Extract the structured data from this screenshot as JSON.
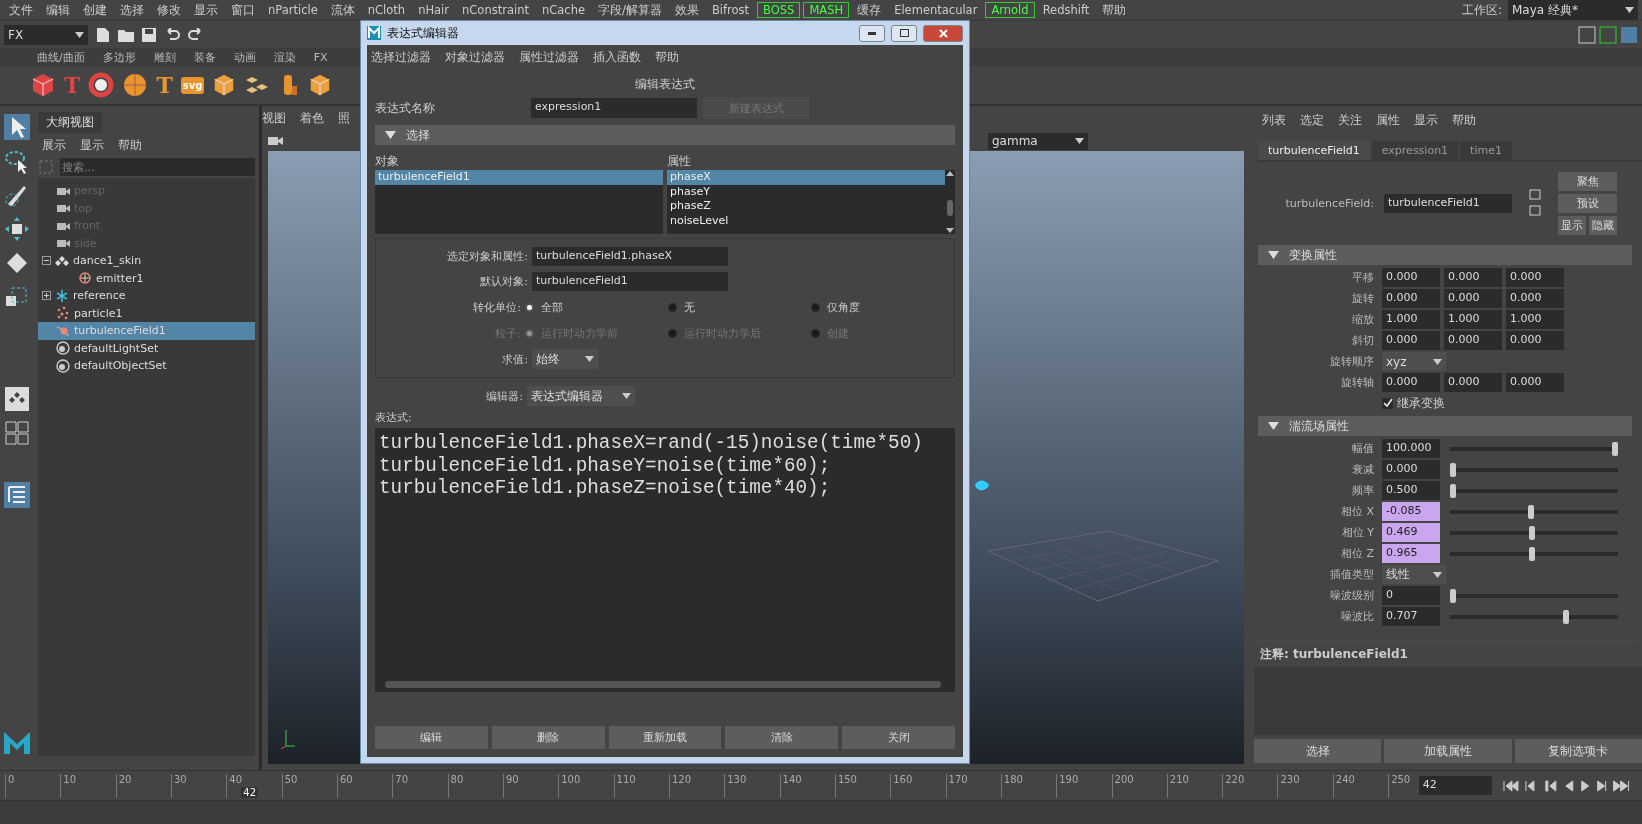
{
  "menu_bar": {
    "items": [
      {
        "label": "文件",
        "kind": "menu"
      },
      {
        "label": "编辑",
        "kind": "menu"
      },
      {
        "label": "创建",
        "kind": "menu"
      },
      {
        "label": "选择",
        "kind": "menu"
      },
      {
        "label": "修改",
        "kind": "menu"
      },
      {
        "label": "显示",
        "kind": "menu"
      },
      {
        "label": "窗口",
        "kind": "menu"
      },
      {
        "label": "nParticle",
        "kind": "menu"
      },
      {
        "label": "流体",
        "kind": "menu"
      },
      {
        "label": "nCloth",
        "kind": "menu"
      },
      {
        "label": "nHair",
        "kind": "menu"
      },
      {
        "label": "nConstraint",
        "kind": "menu"
      },
      {
        "label": "nCache",
        "kind": "menu"
      },
      {
        "label": "字段/解算器",
        "kind": "menu"
      },
      {
        "label": "效果",
        "kind": "menu"
      },
      {
        "label": "Bifrost",
        "kind": "menu"
      },
      {
        "label": "BOSS",
        "kind": "plugin"
      },
      {
        "label": "MASH",
        "kind": "plugin"
      },
      {
        "label": "缓存",
        "kind": "menu"
      },
      {
        "label": "Elementacular",
        "kind": "menu"
      },
      {
        "label": "Arnold",
        "kind": "plugin"
      },
      {
        "label": "Redshift",
        "kind": "menu"
      },
      {
        "label": "帮助",
        "kind": "menu"
      }
    ],
    "workspace_label": "工作区:",
    "workspace": "Maya 经典*"
  },
  "status_line": {
    "menu_set": "FX"
  },
  "shelf": {
    "tabs": [
      "曲线/曲面",
      "多边形",
      "雕刻",
      "装备",
      "动画",
      "渲染",
      "FX"
    ],
    "items": [
      {
        "kind": "poly-cube"
      },
      {
        "kind": "type",
        "glyph": "T"
      },
      {
        "kind": "ring"
      },
      {
        "kind": "sphere"
      },
      {
        "kind": "type",
        "glyph": "T"
      },
      {
        "kind": "type",
        "glyph": "svg"
      },
      {
        "kind": "cube"
      },
      {
        "kind": "scatter"
      },
      {
        "kind": "column"
      },
      {
        "kind": "cube"
      }
    ]
  },
  "outliner": {
    "title": "大纲视图",
    "menu": [
      "展示",
      "显示",
      "帮助"
    ],
    "search_placeholder": "搜索...",
    "items": [
      {
        "label": "persp",
        "kind": "camera",
        "dimmed": true,
        "selected": false
      },
      {
        "label": "top",
        "kind": "camera",
        "dimmed": true,
        "selected": false
      },
      {
        "label": "front",
        "kind": "camera",
        "dimmed": true,
        "selected": false
      },
      {
        "label": "side",
        "kind": "camera",
        "dimmed": true,
        "selected": false
      },
      {
        "label": "dance1_skin",
        "kind": "group",
        "dimmed": false,
        "selected": false,
        "expanded": true,
        "children": [
          {
            "label": "emitter1",
            "kind": "emitter",
            "dimmed": false,
            "selected": false
          }
        ]
      },
      {
        "label": "reference",
        "kind": "reference",
        "dimmed": false,
        "selected": false,
        "expanded": false
      },
      {
        "label": "particle1",
        "kind": "particle",
        "dimmed": false,
        "selected": false
      },
      {
        "label": "turbulenceField1",
        "kind": "field",
        "dimmed": false,
        "selected": true
      },
      {
        "label": "defaultLightSet",
        "kind": "set",
        "dimmed": false,
        "selected": false
      },
      {
        "label": "defaultObjectSet",
        "kind": "set",
        "dimmed": false,
        "selected": false
      }
    ]
  },
  "viewport": {
    "menu": [
      "视图",
      "着色",
      "照"
    ],
    "gamma": "gamma"
  },
  "expression_editor": {
    "title": "表达式编辑器",
    "menu": [
      "选择过滤器",
      "对象过滤器",
      "属性过滤器",
      "插入函数",
      "帮助"
    ],
    "heading": "编辑表达式",
    "name_label": "表达式名称",
    "name": "expression1",
    "new_button": {
      "label": "新建表达式",
      "disabled": true
    },
    "section": {
      "title": "选择",
      "expanded": true
    },
    "objects_label": "对象",
    "objects": [
      {
        "label": "turbulenceField1",
        "selected": true
      }
    ],
    "attributes_label": "属性",
    "attributes": [
      {
        "label": "phaseX",
        "selected": true
      },
      {
        "label": "phaseY",
        "selected": false
      },
      {
        "label": "phaseZ",
        "selected": false
      },
      {
        "label": "noiseLevel",
        "selected": false
      }
    ],
    "selected_label": "选定对象和属性:",
    "selected_value": "turbulenceField1.phaseX",
    "default_label": "默认对象:",
    "default_value": "turbulenceField1",
    "radio_groups": [
      {
        "label": "转化单位:",
        "disabled": false,
        "options": [
          {
            "label": "全部",
            "selected": true
          },
          {
            "label": "无",
            "selected": false
          },
          {
            "label": "仅角度",
            "selected": false
          }
        ]
      },
      {
        "label": "粒子:",
        "disabled": true,
        "options": [
          {
            "label": "运行时动力学前",
            "selected": true
          },
          {
            "label": "运行时动力学后",
            "selected": false
          },
          {
            "label": "创建",
            "selected": false
          }
        ]
      }
    ],
    "evaluate_label": "求值:",
    "evaluate": "始终",
    "editor_label": "编辑器:",
    "editor": "表达式编辑器",
    "expression_label": "表达式:",
    "code": [
      "turbulenceField1.phaseX=rand(-15)noise(time*50)",
      "turbulenceField1.phaseY=noise(time*60);",
      "turbulenceField1.phaseZ=noise(time*40);"
    ],
    "buttons": [
      "编辑",
      "删除",
      "重新加载",
      "清除",
      "关闭"
    ]
  },
  "attribute_editor": {
    "menu": [
      "列表",
      "选定",
      "关注",
      "属性",
      "显示",
      "帮助"
    ],
    "tabs": [
      {
        "label": "turbulenceField1",
        "selected": true
      },
      {
        "label": "expression1",
        "selected": false
      },
      {
        "label": "time1",
        "selected": false
      }
    ],
    "node_label": "turbulenceField:",
    "node_name": "turbulenceField1",
    "side_buttons": [
      "聚焦",
      "预设",
      "显示",
      "隐藏"
    ],
    "sections": [
      {
        "title": "变换属性",
        "expanded": true,
        "rows": [
          {
            "kind": "vector",
            "label": "平移",
            "values": [
              "0.000",
              "0.000",
              "0.000"
            ]
          },
          {
            "kind": "vector",
            "label": "旋转",
            "values": [
              "0.000",
              "0.000",
              "0.000"
            ]
          },
          {
            "kind": "vector",
            "label": "缩放",
            "values": [
              "1.000",
              "1.000",
              "1.000"
            ]
          },
          {
            "kind": "vector",
            "label": "斜切",
            "values": [
              "0.000",
              "0.000",
              "0.000"
            ]
          },
          {
            "kind": "dropdown",
            "label": "旋转顺序",
            "value": "xyz"
          },
          {
            "kind": "vector",
            "label": "旋转轴",
            "values": [
              "0.000",
              "0.000",
              "0.000"
            ]
          },
          {
            "kind": "checkbox",
            "label": "继承变换",
            "checked": true
          }
        ]
      },
      {
        "title": "湍流场属性",
        "expanded": true,
        "rows": [
          {
            "kind": "slider",
            "label": "幅值",
            "value": "100.000",
            "level": 1,
            "driven": false
          },
          {
            "kind": "slider",
            "label": "衰减",
            "value": "0.000",
            "level": 0,
            "driven": false
          },
          {
            "kind": "slider",
            "label": "频率",
            "value": "0.500",
            "level": 0,
            "driven": false
          },
          {
            "kind": "slider",
            "label": "相位 X",
            "value": "-0.085",
            "level": 0.48,
            "driven": true
          },
          {
            "kind": "slider",
            "label": "相位 Y",
            "value": "0.469",
            "level": 0.485,
            "driven": true
          },
          {
            "kind": "slider",
            "label": "相位 Z",
            "value": "0.965",
            "level": 0.49,
            "driven": true
          },
          {
            "kind": "dropdown",
            "label": "插值类型",
            "value": "线性"
          },
          {
            "kind": "slider",
            "label": "噪波级别",
            "value": "0",
            "level": 0,
            "driven": false
          },
          {
            "kind": "slider",
            "label": "噪波比",
            "value": "0.707",
            "level": 0.7,
            "driven": false
          }
        ]
      }
    ],
    "notes": "注释:  turbulenceField1",
    "bottom_buttons": [
      "选择",
      "加载属性",
      "复制选项卡"
    ]
  },
  "timeline": {
    "ticks": [
      "0",
      "10",
      "20",
      "30",
      "40",
      "50",
      "60",
      "70",
      "80",
      "90",
      "100",
      "110",
      "120",
      "130",
      "140",
      "150",
      "160",
      "170",
      "180",
      "190",
      "200",
      "210",
      "220",
      "230",
      "240",
      "250"
    ],
    "playhead": {
      "label": "42",
      "level": 0.168
    },
    "current_frame": "42"
  }
}
